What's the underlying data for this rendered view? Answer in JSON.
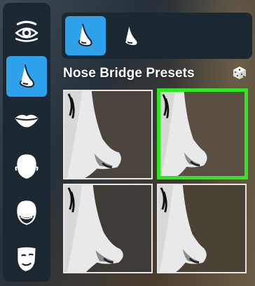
{
  "sidebar": {
    "items": [
      {
        "icon": "eye-icon",
        "active": false
      },
      {
        "icon": "nose-icon",
        "active": true
      },
      {
        "icon": "mouth-icon",
        "active": false
      },
      {
        "icon": "face-shape-icon",
        "active": false
      },
      {
        "icon": "jaw-icon",
        "active": false
      },
      {
        "icon": "mask-icon",
        "active": false
      }
    ]
  },
  "tabs": [
    {
      "icon": "nose-bridge-icon",
      "active": true
    },
    {
      "icon": "nose-tip-icon",
      "active": false
    }
  ],
  "section": {
    "title": "Nose Bridge Presets",
    "randomize_icon": "dice-icon"
  },
  "presets": [
    {
      "id": 1,
      "selected": false
    },
    {
      "id": 2,
      "selected": true
    },
    {
      "id": 3,
      "selected": false
    },
    {
      "id": 4,
      "selected": false
    }
  ],
  "colors": {
    "accent": "#2ea1ec",
    "selection": "#2ee81e",
    "panel": "#1b2731"
  }
}
